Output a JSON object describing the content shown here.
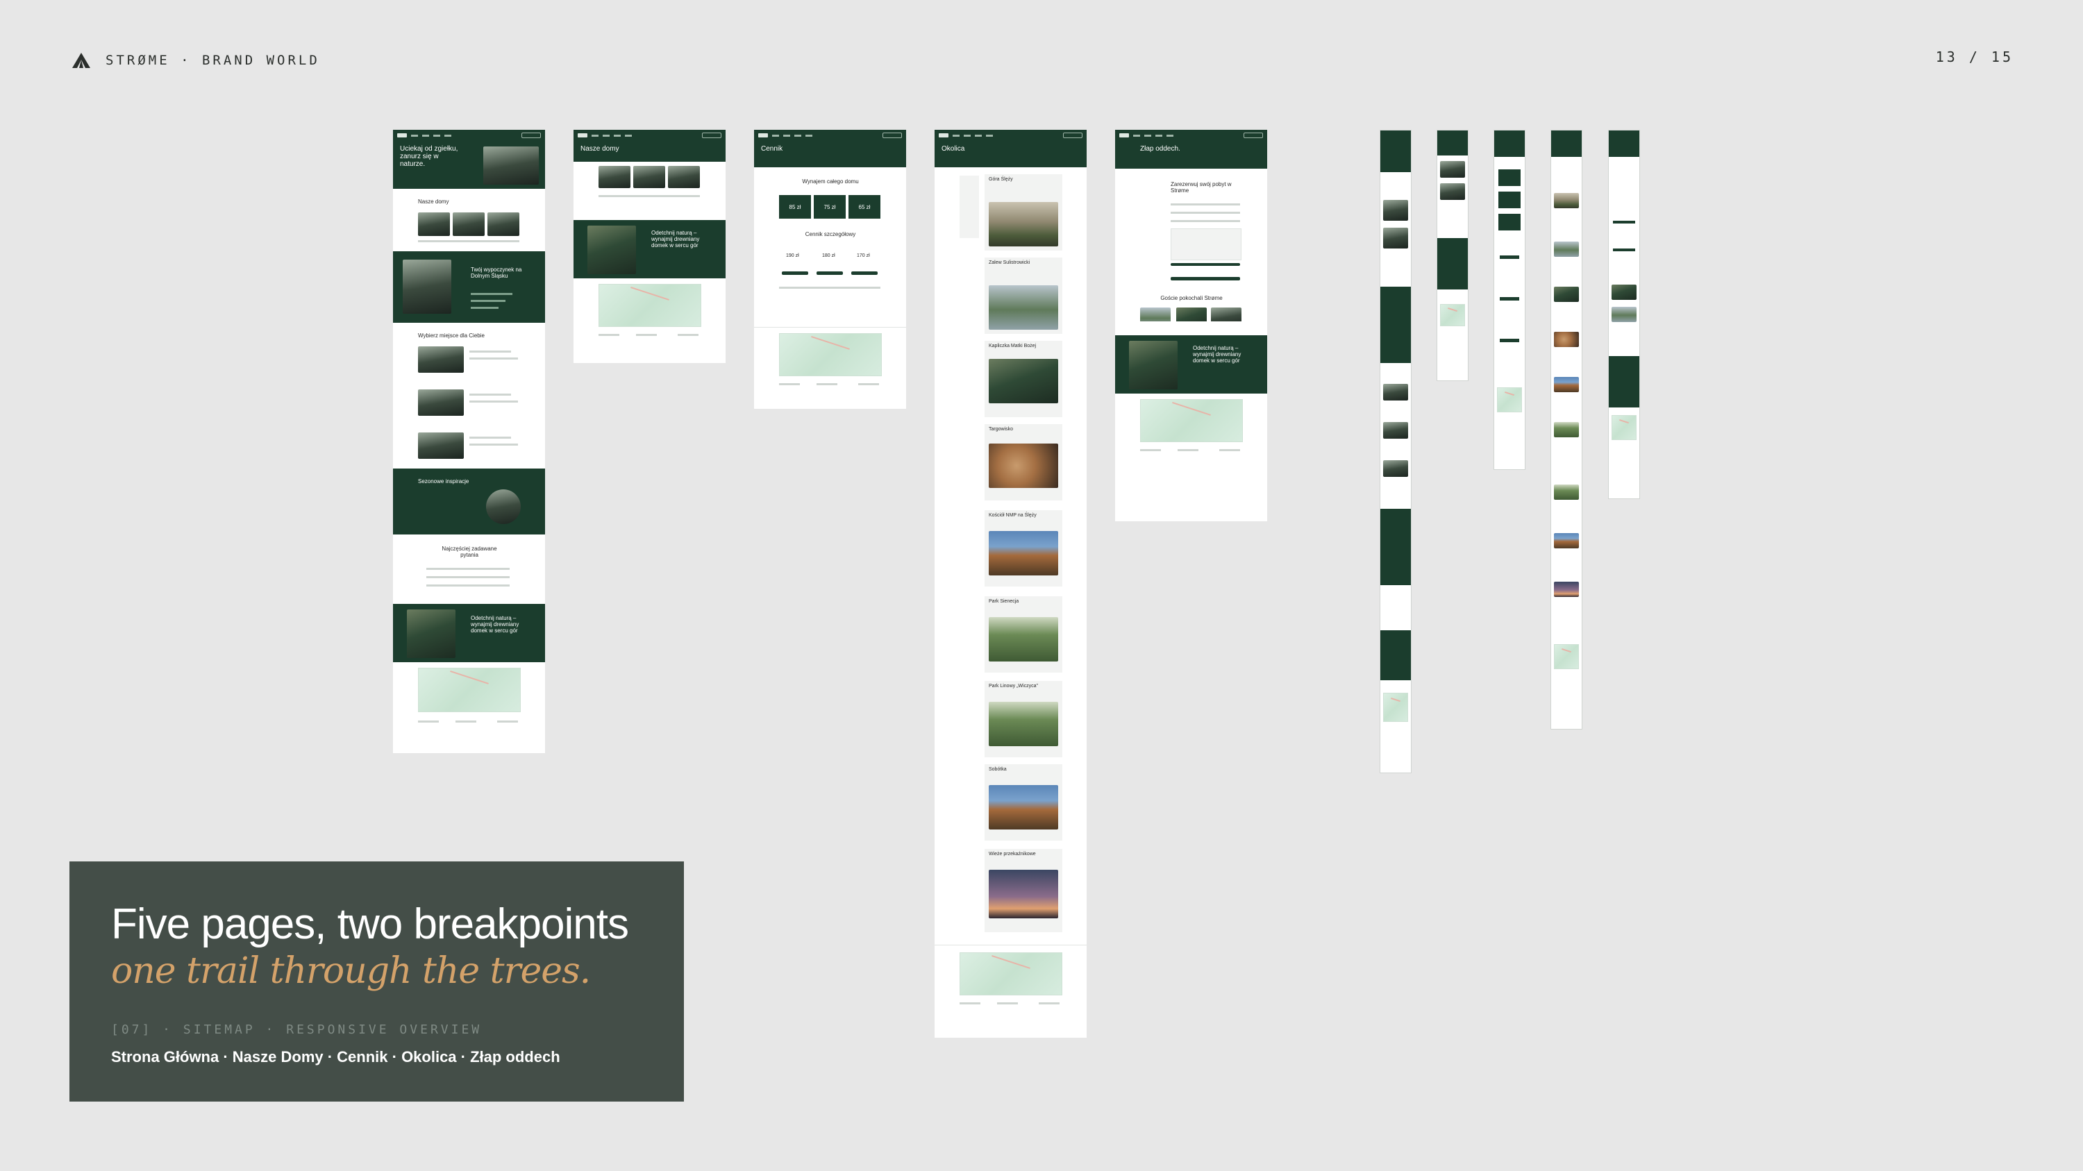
{
  "header": {
    "brand": "STRØME · BRAND WORLD",
    "page_counter": "13 / 15"
  },
  "colors": {
    "forest": "#1b3d2d",
    "panel": "#444e48",
    "accent": "#d4a26a",
    "background": "#e7e7e7"
  },
  "icons": {
    "brand": "strome-tree-icon"
  },
  "desktop_pages": {
    "home": {
      "hero": "Uciekaj od zgiełku, zanurz się w naturze.",
      "section_houses": "Nasze domy",
      "section_retreat": "Twój wypoczynek na Dolnym Śląsku",
      "section_places": "Wybierz miejsce dla Ciebie",
      "section_inspiration": "Sezonowe inspiracje",
      "section_faq": "Najczęściej zadawane pytania",
      "section_cta": "Odetchnij naturą – wynajmij drewniany domek w sercu gór"
    },
    "houses": {
      "hero": "Nasze domy",
      "section_cta": "Odetchnij naturą – wynajmij drewniany domek w sercu gór"
    },
    "pricing": {
      "hero": "Cennik",
      "section_whole": "Wynajem całego domu",
      "prices": [
        "85 zł",
        "75 zł",
        "65 zł"
      ],
      "section_detailed": "Cennik szczegółowy",
      "detailed_prices": [
        "190 zł",
        "180 zł",
        "170 zł"
      ]
    },
    "area": {
      "hero": "Okolica",
      "places": [
        "Góra Ślęży",
        "Zalew Sulistrowicki",
        "Kapliczka Matki Bożej",
        "Targowisko",
        "Kościół NMP na Ślęży",
        "Park Sienecja",
        "Park Linowy „Wiczyca”",
        "Sobótka",
        "Wieże przekaźnikowe"
      ]
    },
    "contact": {
      "hero": "Złap oddech.",
      "form_title": "Zarezerwuj swój pobyt w Strøme",
      "section_gallery": "Goście pokochali Strøme",
      "section_cta": "Odetchnij naturą – wynajmij drewniany domek w sercu gór"
    }
  },
  "panel": {
    "title": "Five pages, two breakpoints",
    "subtitle": "one trail through the trees.",
    "meta": "[07] · SITEMAP · RESPONSIVE OVERVIEW",
    "pages": "Strona Główna · Nasze Domy · Cennik · Okolica · Złap oddech"
  }
}
